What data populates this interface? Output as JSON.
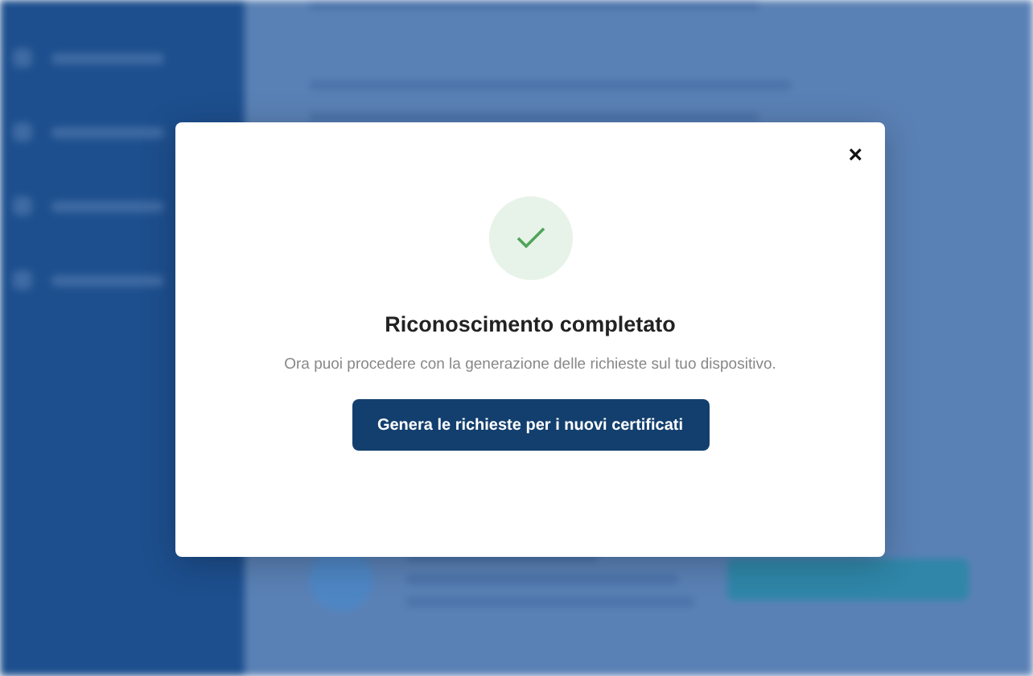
{
  "dialog": {
    "close": "×",
    "completed": true,
    "title": "Riconoscimento completato",
    "message": "Ora puoi procedere con la generazione delle richieste sul tuo dispositivo.",
    "button": "Genera le richieste per i nuovi certificati"
  }
}
